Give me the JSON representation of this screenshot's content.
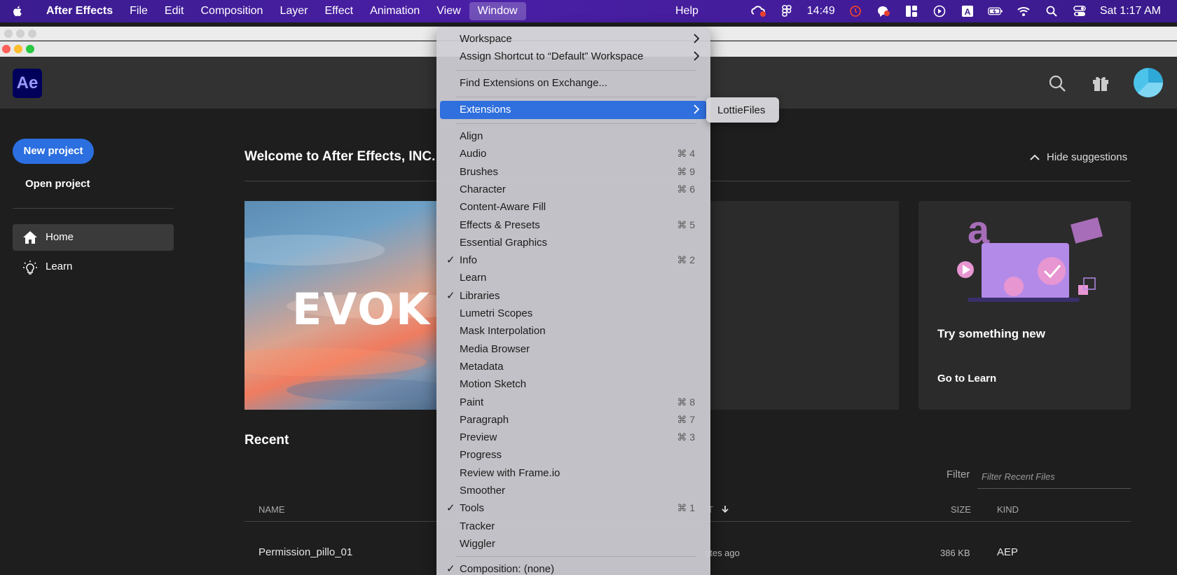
{
  "menubar": {
    "app_name": "After Effects",
    "items": [
      "File",
      "Edit",
      "Composition",
      "Layer",
      "Effect",
      "Animation",
      "View",
      "Window"
    ],
    "active_item": "Window",
    "help": "Help",
    "clock": "14:49",
    "datetime": "Sat  1:17 AM",
    "icons": [
      "apple-icon",
      "creative-cloud-icon",
      "figma-icon",
      "timer-icon",
      "chat-icon",
      "layout-icon",
      "play-icon",
      "input-source-icon",
      "battery-icon",
      "wifi-icon",
      "spotlight-icon",
      "control-center-icon"
    ]
  },
  "app": {
    "logo": "Ae",
    "new_project": "New project",
    "open_project": "Open project",
    "nav": [
      {
        "label": "Home",
        "icon": "home-icon"
      },
      {
        "label": "Learn",
        "icon": "lightbulb-icon"
      }
    ],
    "welcome": "Welcome to After Effects, INC.",
    "hide_suggestions": "Hide suggestions",
    "hero_text": "EVOK",
    "try_title": "Try something new",
    "try_link": "Go to Learn",
    "recent_title": "Recent",
    "filter_label": "Filter",
    "filter_placeholder": "Filter Recent Files",
    "columns": {
      "name": "NAME",
      "opened": "T",
      "size": "SIZE",
      "kind": "KIND"
    },
    "rows": [
      {
        "name": "Permission_pillo_01",
        "opened": "utes ago",
        "size": "386 KB",
        "kind": "AEP"
      }
    ]
  },
  "dropdown": {
    "workspace": "Workspace",
    "assign_shortcut": "Assign Shortcut to “Default” Workspace",
    "find_extensions": "Find Extensions on Exchange...",
    "extensions": "Extensions",
    "items": [
      {
        "label": "Align",
        "shortcut": "",
        "checked": false
      },
      {
        "label": "Audio",
        "shortcut": "⌘ 4",
        "checked": false
      },
      {
        "label": "Brushes",
        "shortcut": "⌘ 9",
        "checked": false
      },
      {
        "label": "Character",
        "shortcut": "⌘ 6",
        "checked": false
      },
      {
        "label": "Content-Aware Fill",
        "shortcut": "",
        "checked": false
      },
      {
        "label": "Effects & Presets",
        "shortcut": "⌘ 5",
        "checked": false
      },
      {
        "label": "Essential Graphics",
        "shortcut": "",
        "checked": false
      },
      {
        "label": "Info",
        "shortcut": "⌘ 2",
        "checked": true
      },
      {
        "label": "Learn",
        "shortcut": "",
        "checked": false
      },
      {
        "label": "Libraries",
        "shortcut": "",
        "checked": true
      },
      {
        "label": "Lumetri Scopes",
        "shortcut": "",
        "checked": false
      },
      {
        "label": "Mask Interpolation",
        "shortcut": "",
        "checked": false
      },
      {
        "label": "Media Browser",
        "shortcut": "",
        "checked": false
      },
      {
        "label": "Metadata",
        "shortcut": "",
        "checked": false
      },
      {
        "label": "Motion Sketch",
        "shortcut": "",
        "checked": false
      },
      {
        "label": "Paint",
        "shortcut": "⌘ 8",
        "checked": false
      },
      {
        "label": "Paragraph",
        "shortcut": "⌘ 7",
        "checked": false
      },
      {
        "label": "Preview",
        "shortcut": "⌘ 3",
        "checked": false
      },
      {
        "label": "Progress",
        "shortcut": "",
        "checked": false
      },
      {
        "label": "Review with Frame.io",
        "shortcut": "",
        "checked": false
      },
      {
        "label": "Smoother",
        "shortcut": "",
        "checked": false
      },
      {
        "label": "Tools",
        "shortcut": "⌘ 1",
        "checked": true
      },
      {
        "label": "Tracker",
        "shortcut": "",
        "checked": false
      },
      {
        "label": "Wiggler",
        "shortcut": "",
        "checked": false
      }
    ],
    "composition": "Composition: (none)",
    "check_mark": "✓"
  },
  "submenu": {
    "items": [
      "LottieFiles"
    ]
  },
  "colors": {
    "menubar": "#3b1c8f",
    "highlight": "#2f6fde",
    "accent_button": "#2b6fe0",
    "app_bg": "#1e1e1e"
  }
}
